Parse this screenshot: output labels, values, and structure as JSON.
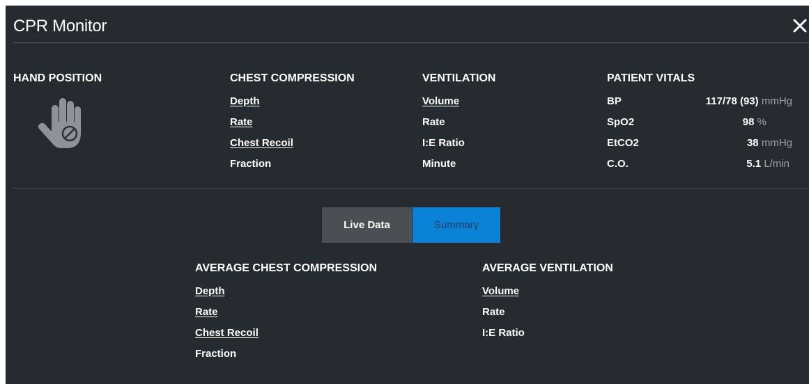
{
  "window": {
    "title": "CPR Monitor",
    "close_icon": "close-icon"
  },
  "hand_position": {
    "heading": "HAND POSITION",
    "icon": "hand-blocked-icon"
  },
  "chest_compression": {
    "heading": "CHEST COMPRESSION",
    "items": [
      "Depth",
      "Rate",
      "Chest Recoil",
      "Fraction"
    ]
  },
  "ventilation": {
    "heading": "VENTILATION",
    "items": [
      "Volume",
      "Rate",
      "I:E Ratio",
      "Minute"
    ]
  },
  "patient_vitals": {
    "heading": "PATIENT VITALS",
    "rows": [
      {
        "label": "BP",
        "value": "117/78 (93)",
        "unit": "mmHg"
      },
      {
        "label": "SpO2",
        "value": "98",
        "unit": "%"
      },
      {
        "label": "EtCO2",
        "value": "38",
        "unit": "mmHg"
      },
      {
        "label": "C.O.",
        "value": "5.1",
        "unit": "L/min"
      }
    ]
  },
  "tabs": {
    "live": "Live Data",
    "summary": "Summary",
    "selected": "Summary"
  },
  "avg_chest_compression": {
    "heading": "AVERAGE CHEST COMPRESSION",
    "items": [
      "Depth",
      "Rate",
      "Chest Recoil",
      "Fraction"
    ]
  },
  "avg_ventilation": {
    "heading": "AVERAGE VENTILATION",
    "items": [
      "Volume",
      "Rate",
      "I:E Ratio"
    ]
  },
  "colors": {
    "background": "#262b30",
    "accent": "#0a82d6",
    "tab_inactive": "#4a4f54",
    "unit_text": "#9aa3ab"
  }
}
